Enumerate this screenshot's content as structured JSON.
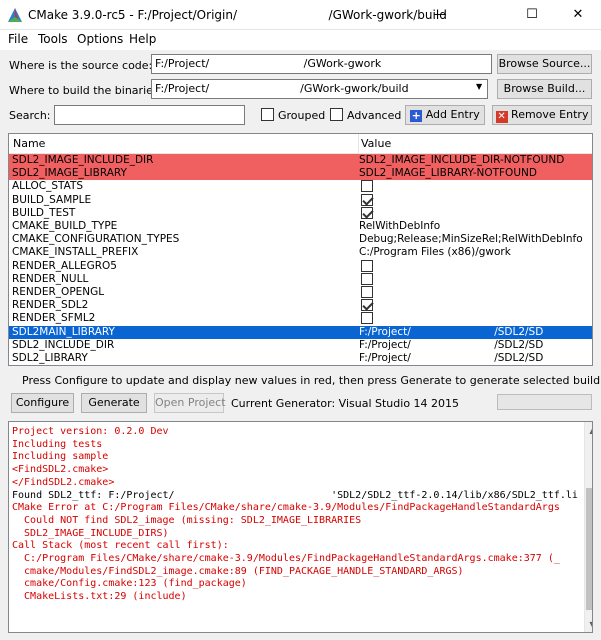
{
  "window": {
    "title": "CMake 3.9.0-rc5 - F:/Project/Origin/                        /GWork-gwork/build",
    "minimize": "—",
    "maximize": "☐",
    "close": "✕"
  },
  "menu": {
    "file": "File",
    "tools": "Tools",
    "options": "Options",
    "help": "Help"
  },
  "source": {
    "label": "Where is the source code:",
    "value": "F:/Project/                           /GWork-gwork",
    "browse": "Browse Source..."
  },
  "build": {
    "label": "Where to build the binaries:",
    "value": "F:/Project/                          /GWork-gwork/build",
    "browse": "Browse Build..."
  },
  "search": {
    "label": "Search:",
    "value": "",
    "grouped": "Grouped",
    "grouped_checked": false,
    "advanced": "Advanced",
    "advanced_checked": false,
    "add_entry": "Add Entry",
    "remove_entry": "Remove Entry"
  },
  "table": {
    "col_name": "Name",
    "col_value": "Value",
    "rows": [
      {
        "name": "SDL2_IMAGE_INCLUDE_DIR",
        "value": "SDL2_IMAGE_INCLUDE_DIR-NOTFOUND",
        "style": "red"
      },
      {
        "name": "SDL2_IMAGE_LIBRARY",
        "value": "SDL2_IMAGE_LIBRARY-NOTFOUND",
        "style": "red"
      },
      {
        "name": "ALLOC_STATS",
        "check": false
      },
      {
        "name": "BUILD_SAMPLE",
        "check": true
      },
      {
        "name": "BUILD_TEST",
        "check": true
      },
      {
        "name": "CMAKE_BUILD_TYPE",
        "value": "RelWithDebInfo"
      },
      {
        "name": "CMAKE_CONFIGURATION_TYPES",
        "value": "Debug;Release;MinSizeRel;RelWithDebInfo"
      },
      {
        "name": "CMAKE_INSTALL_PREFIX",
        "value": "C:/Program Files (x86)/gwork"
      },
      {
        "name": "RENDER_ALLEGRO5",
        "check": false
      },
      {
        "name": "RENDER_NULL",
        "check": false
      },
      {
        "name": "RENDER_OPENGL",
        "check": false
      },
      {
        "name": "RENDER_SDL2",
        "check": true
      },
      {
        "name": "RENDER_SFML2",
        "check": false
      },
      {
        "name": "SDL2MAIN_LIBRARY",
        "value": "F:/Project/                         /SDL2/SD",
        "style": "sel"
      },
      {
        "name": "SDL2_INCLUDE_DIR",
        "value": "F:/Project/                         /SDL2/SD"
      },
      {
        "name": "SDL2_LIBRARY",
        "value": "F:/Project/                         /SDL2/SD"
      }
    ]
  },
  "hint": "Press Configure to update and display new values in red, then press Generate to generate selected build files.",
  "actions": {
    "configure": "Configure",
    "generate": "Generate",
    "open_project": "Open Project",
    "generator": "Current Generator: Visual Studio 14 2015"
  },
  "output": [
    {
      "text": "Project version: 0.2.0 Dev",
      "color": "red"
    },
    {
      "text": "Including tests",
      "color": "red"
    },
    {
      "text": "Including sample",
      "color": "red"
    },
    {
      "text": "<FindSDL2.cmake>",
      "color": "red"
    },
    {
      "text": "</FindSDL2.cmake>",
      "color": "red"
    },
    {
      "text": "Found SDL2_ttf: F:/Project/                          'SDL2/SDL2_ttf-2.0.14/lib/x86/SDL2_ttf.li",
      "color": "black"
    },
    {
      "text": "CMake Error at C:/Program Files/CMake/share/cmake-3.9/Modules/FindPackageHandleStandardArgs",
      "color": "red"
    },
    {
      "text": "  Could NOT find SDL2_image (missing: SDL2_IMAGE_LIBRARIES",
      "color": "red"
    },
    {
      "text": "  SDL2_IMAGE_INCLUDE_DIRS)",
      "color": "red"
    },
    {
      "text": "Call Stack (most recent call first):",
      "color": "red"
    },
    {
      "text": "  C:/Program Files/CMake/share/cmake-3.9/Modules/FindPackageHandleStandardArgs.cmake:377 (_",
      "color": "red"
    },
    {
      "text": "  cmake/Modules/FindSDL2_image.cmake:89 (FIND_PACKAGE_HANDLE_STANDARD_ARGS)",
      "color": "red"
    },
    {
      "text": "  cmake/Config.cmake:123 (find_package)",
      "color": "red"
    },
    {
      "text": "  CMakeLists.txt:29 (include)",
      "color": "red"
    }
  ],
  "colors": {
    "error_row": "#f06060",
    "selection": "#0a64d2",
    "error_text": "#d80000"
  },
  "icons": {
    "app": "cmake-triangle-icon",
    "add": "plus-icon",
    "remove": "remove-x-icon"
  }
}
